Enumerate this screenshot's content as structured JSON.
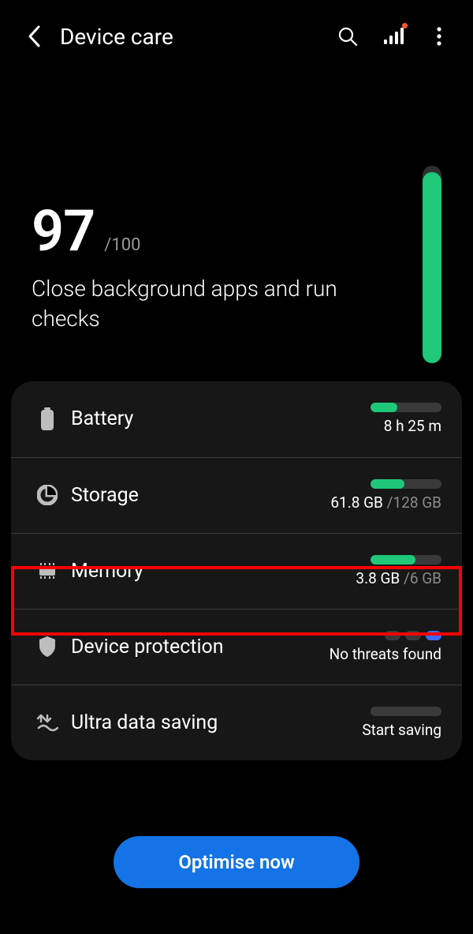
{
  "header": {
    "title": "Device care"
  },
  "score": {
    "value": "97",
    "max": "/100",
    "message": "Close background apps and run checks",
    "fill_percent": 97
  },
  "rows": {
    "battery": {
      "label": "Battery",
      "value": "8 h 25 m",
      "fill_percent": 38
    },
    "storage": {
      "label": "Storage",
      "used": "61.8 GB",
      "sep": " /",
      "total": "128 GB",
      "fill_percent": 48
    },
    "memory": {
      "label": "Memory",
      "used": "3.8 GB",
      "sep": " /",
      "total": "6 GB",
      "fill_percent": 63
    },
    "protection": {
      "label": "Device protection",
      "value": "No threats found"
    },
    "datasaving": {
      "label": "Ultra data saving",
      "value": "Start saving"
    }
  },
  "button": {
    "optimise": "Optimise now"
  }
}
